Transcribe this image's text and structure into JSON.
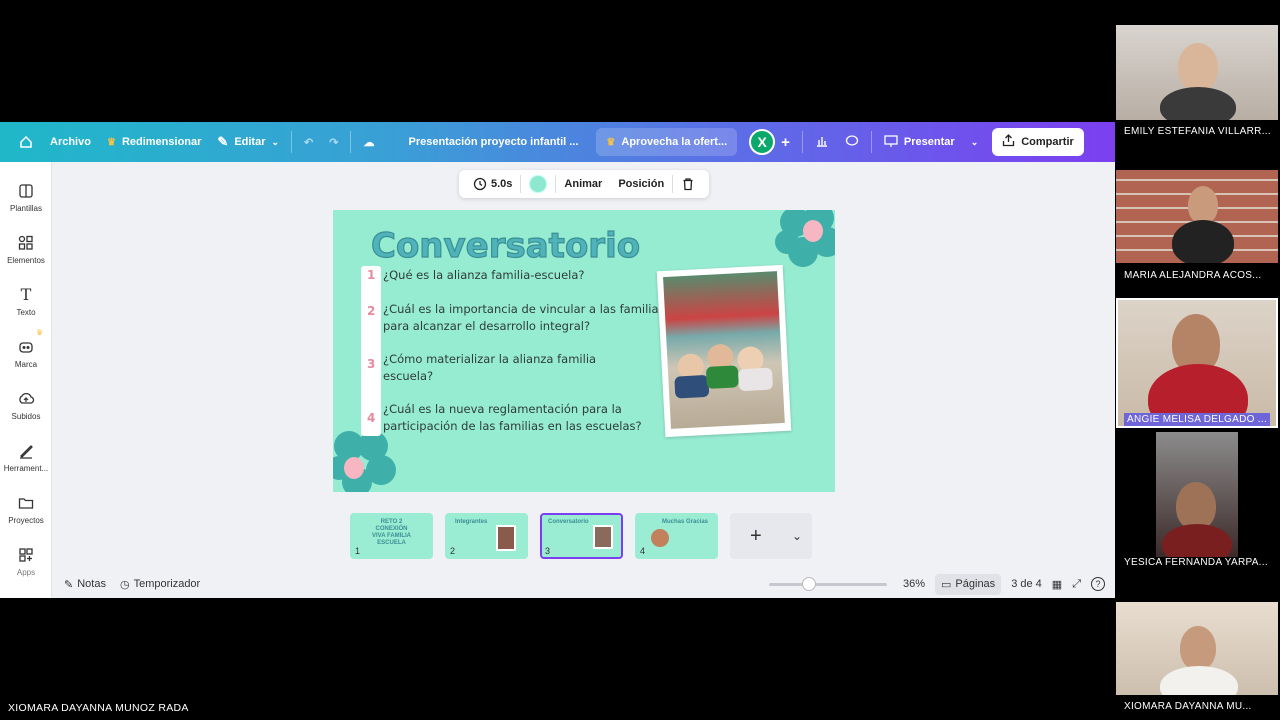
{
  "topbar": {
    "home_icon": "home-icon",
    "file_label": "Archivo",
    "resize_label": "Redimensionar",
    "edit_label": "Editar",
    "title": "Presentación proyecto infantil ...",
    "promo_label": "Aprovecha la ofert...",
    "avatar_letter": "X",
    "present_label": "Presentar",
    "share_label": "Compartir"
  },
  "sidebar": {
    "items": [
      {
        "label": "Plantillas",
        "icon": "templates-icon"
      },
      {
        "label": "Elementos",
        "icon": "elements-icon"
      },
      {
        "label": "Texto",
        "icon": "text-icon"
      },
      {
        "label": "Marca",
        "icon": "brand-icon"
      },
      {
        "label": "Subidos",
        "icon": "upload-icon"
      },
      {
        "label": "Herrament...",
        "icon": "tools-icon"
      },
      {
        "label": "Proyectos",
        "icon": "folder-icon"
      },
      {
        "label": "Apps",
        "icon": "apps-icon"
      }
    ]
  },
  "context_toolbar": {
    "duration": "5.0s",
    "animate_label": "Animar",
    "position_label": "Posición"
  },
  "slide": {
    "title": "Conversatorio",
    "questions": [
      {
        "num": "1",
        "text": "¿Qué es la alianza familia-escuela?"
      },
      {
        "num": "2",
        "text": "¿Cuál es la importancia de vincular a las familias para alcanzar el desarrollo integral?"
      },
      {
        "num": "3",
        "text": " ¿Cómo materializar la alianza familia escuela?"
      },
      {
        "num": "4",
        "text": "¿Cuál es la nueva reglamentación para la participación de las familias en las escuelas?"
      }
    ]
  },
  "thumbnails": [
    {
      "num": "1",
      "title": "RETO 2 CONEXIÓN VIVA FAMILIA ESCUELA"
    },
    {
      "num": "2",
      "title": "Integrantes"
    },
    {
      "num": "3",
      "title": "Conversatorio"
    },
    {
      "num": "4",
      "title": "Muchas Gracias"
    }
  ],
  "bottombar": {
    "notes_label": "Notas",
    "timer_label": "Temporizador",
    "zoom": "36%",
    "pages_label": "Páginas",
    "page_indicator": "3 de 4"
  },
  "participants": [
    {
      "name": "EMILY ESTEFANIA VILLARR..."
    },
    {
      "name": "MARIA ALEJANDRA ACOS..."
    },
    {
      "name": "ANGIE MELISA DELGADO ..."
    },
    {
      "name": "YESICA FERNANDA YARPA..."
    },
    {
      "name": "XIOMARA DAYANNA MU..."
    }
  ],
  "screen_sharer": "XIOMARA DAYANNA MUNOZ RADA",
  "colors": {
    "accent": "#7c3ff0",
    "slide_bg": "#96ecd1",
    "highlight": "#6e65d9"
  }
}
